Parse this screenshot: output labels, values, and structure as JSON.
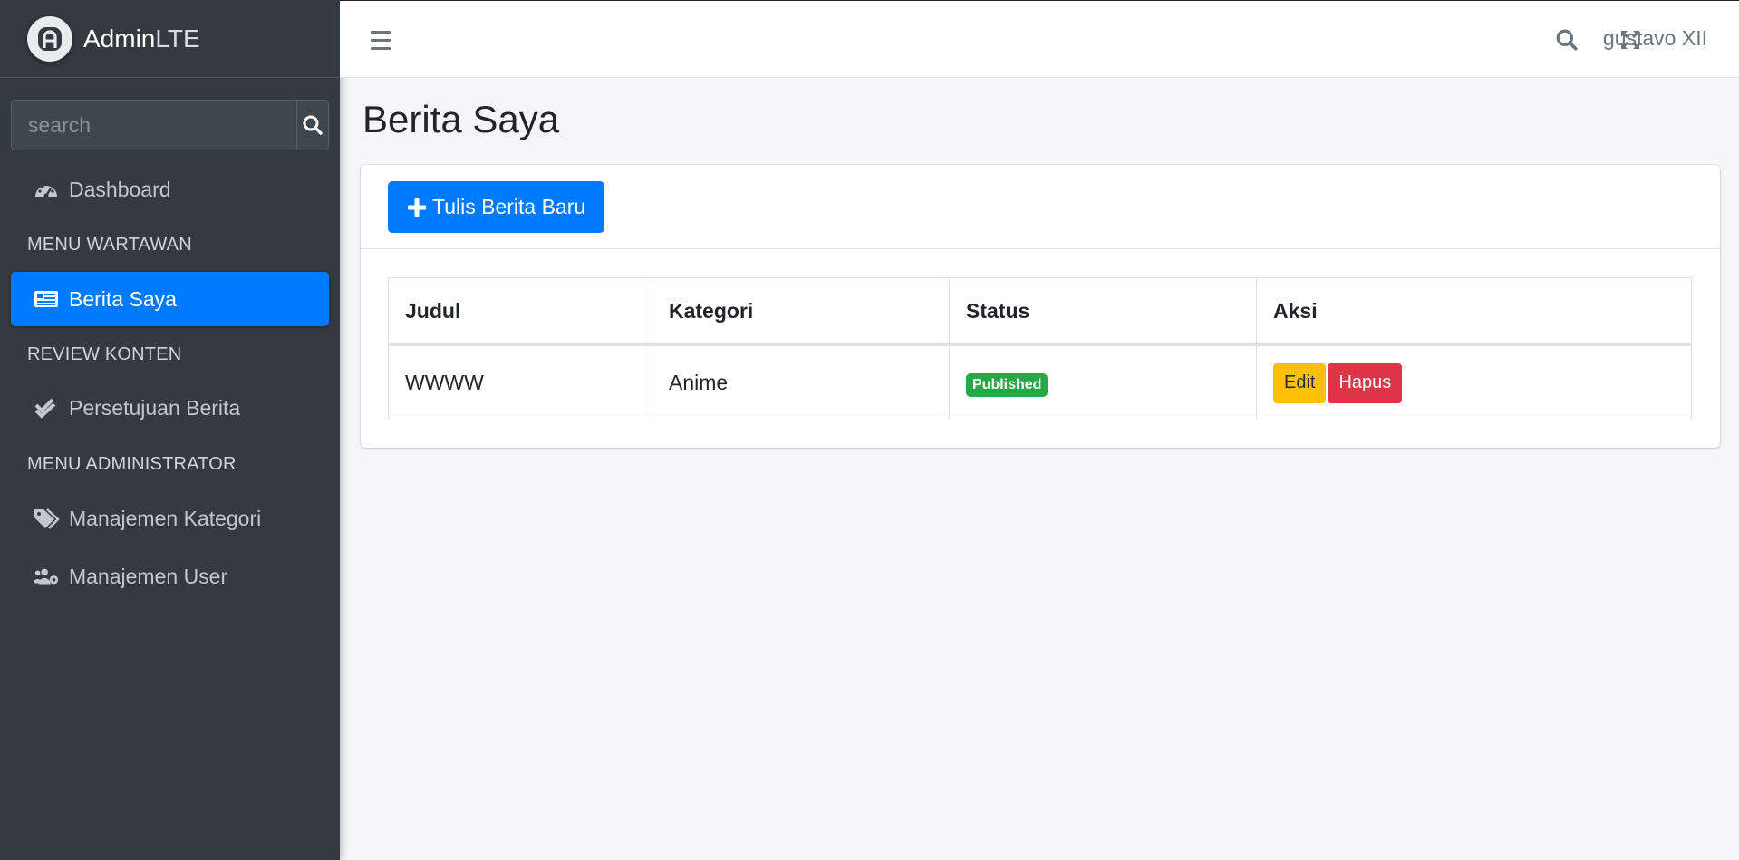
{
  "brand": {
    "name_bold": "Admin",
    "name_light": "LTE",
    "logo_icon": "adminlte-logo-icon"
  },
  "sidebar": {
    "search_placeholder": "search",
    "search_icon": "search-icon",
    "items": {
      "dashboard": {
        "label": "Dashboard",
        "icon": "tachometer-icon"
      },
      "berita_saya": {
        "label": "Berita Saya",
        "icon": "newspaper-icon",
        "active": true
      },
      "persetujuan": {
        "label": "Persetujuan Berita",
        "icon": "check-double-icon"
      },
      "kategori": {
        "label": "Manajemen Kategori",
        "icon": "tags-icon"
      },
      "user": {
        "label": "Manajemen User",
        "icon": "users-cog-icon"
      }
    },
    "headers": {
      "wartawan": "MENU WARTAWAN",
      "review": "REVIEW KONTEN",
      "admin": "MENU ADMINISTRATOR"
    }
  },
  "topbar": {
    "menu_icon": "bars-icon",
    "search_icon": "search-icon",
    "fullscreen_icon": "expand-arrows-icon",
    "user_name": "gustavo XII"
  },
  "page": {
    "title": "Berita Saya"
  },
  "card": {
    "new_button_label": "Tulis Berita Baru",
    "table": {
      "headers": {
        "judul": "Judul",
        "kategori": "Kategori",
        "status": "Status",
        "aksi": "Aksi"
      },
      "rows": [
        {
          "judul": "WWWW",
          "kategori": "Anime",
          "status": "Published",
          "edit": "Edit",
          "hapus": "Hapus"
        }
      ]
    }
  },
  "colors": {
    "primary": "#007bff",
    "sidebar_bg": "#343a40",
    "success": "#28a745",
    "warning": "#ffc107",
    "danger": "#dc3545",
    "content_bg": "#f4f6f9"
  }
}
